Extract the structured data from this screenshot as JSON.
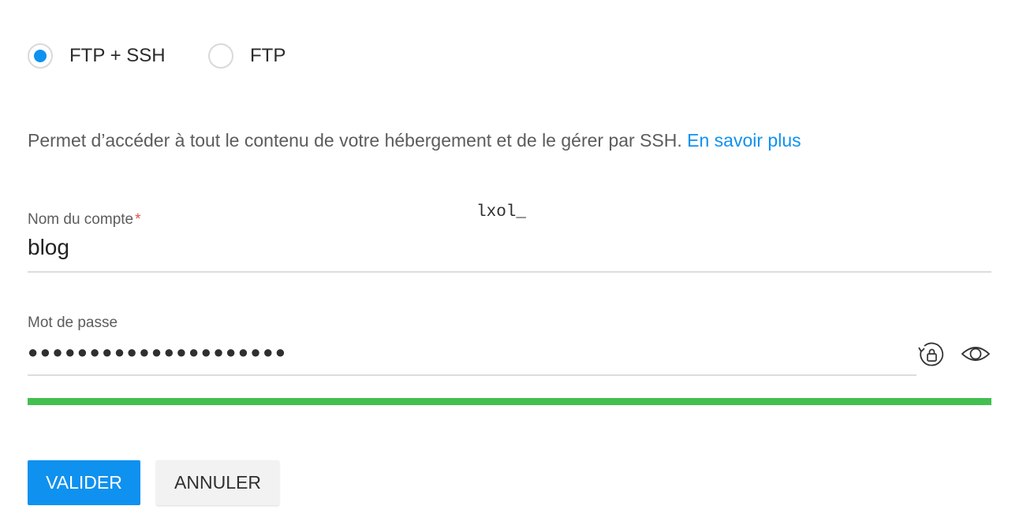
{
  "connection_type": {
    "options": [
      {
        "label": "FTP + SSH",
        "selected": true
      },
      {
        "label": "FTP",
        "selected": false
      }
    ]
  },
  "description": {
    "text": "Permet d’accéder à tout le contenu de votre hébergement et de le gérer par SSH.",
    "link_label": "En savoir plus"
  },
  "account": {
    "label": "Nom du compte",
    "required_mark": "*",
    "prefix": "lxol_",
    "value": "blog"
  },
  "password": {
    "label": "Mot de passe",
    "masked_value": "●●●●●●●●●●●●●●●●●●●●●",
    "strength_fraction": 1.0
  },
  "buttons": {
    "validate_label": "VALIDER",
    "cancel_label": "ANNULER"
  },
  "colors": {
    "accent": "#0f91ef",
    "strength": "#43bf4f",
    "required": "#e0504a"
  },
  "icons": {
    "regenerate": "refresh-lock-icon",
    "show_password": "eye-icon"
  }
}
